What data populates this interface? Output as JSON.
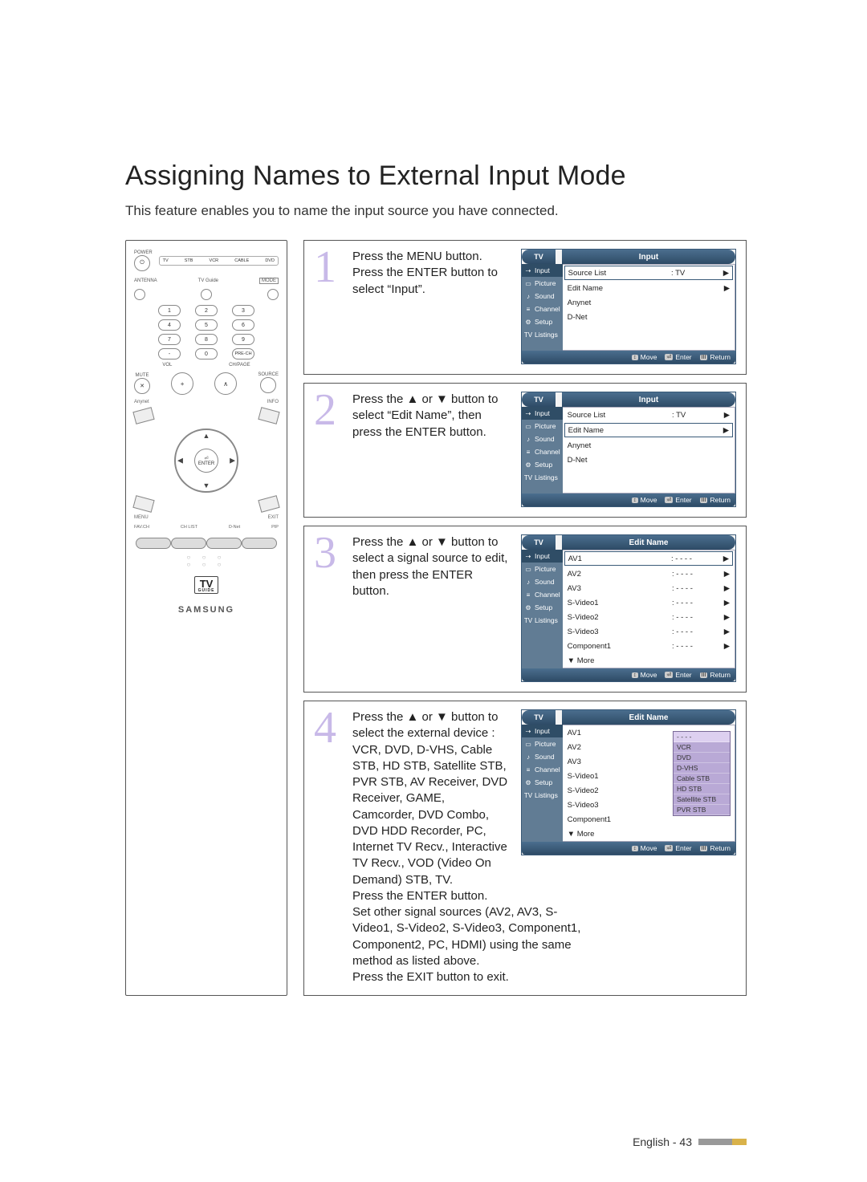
{
  "page": {
    "title": "Assigning Names to External Input Mode",
    "intro": "This feature enables you to name the input source you have connected.",
    "footer_label": "English - 43"
  },
  "remote": {
    "power": "POWER",
    "mode_strip": [
      "TV",
      "STB",
      "VCR",
      "CABLE",
      "DVD"
    ],
    "row2_labels": [
      "ANTENNA",
      "TV Guide",
      "MODE"
    ],
    "numbers": [
      "1",
      "2",
      "3",
      "4",
      "5",
      "6",
      "7",
      "8",
      "9",
      "-",
      "0",
      "PRE-CH"
    ],
    "vol_label": "VOL",
    "chpage_label": "CH/PAGE",
    "mute": "MUTE",
    "source": "SOURCE",
    "corner_tl": "Anynet",
    "corner_tr": "INFO",
    "corner_bl": "MENU",
    "corner_br": "EXIT",
    "enter": "ENTER",
    "bottom4": [
      "FAV.CH",
      "CH LIST",
      "D-Net",
      "PIP"
    ],
    "tvguide_main": "TV",
    "tvguide_sub": "GUIDE",
    "brand": "SAMSUNG"
  },
  "steps": [
    {
      "num": "1",
      "text": "Press the MENU button.\nPress the ENTER button to select “Input”.",
      "osd": {
        "title_left": "TV",
        "title_right": "Input",
        "side_items": [
          "Input",
          "Picture",
          "Sound",
          "Channel",
          "Setup",
          "Listings"
        ],
        "side_selected": 0,
        "main_rows": [
          {
            "label": "Source List",
            "value": ": TV",
            "selected": true,
            "arrow": "▶"
          },
          {
            "label": "Edit Name",
            "value": "",
            "arrow": "▶"
          },
          {
            "label": "Anynet",
            "value": "",
            "arrow": ""
          },
          {
            "label": "D-Net",
            "value": "",
            "arrow": ""
          }
        ],
        "footer": [
          "Move",
          "Enter",
          "Return"
        ]
      }
    },
    {
      "num": "2",
      "text": "Press the ▲ or ▼ button to select “Edit Name”, then press the ENTER button.",
      "osd": {
        "title_left": "TV",
        "title_right": "Input",
        "side_items": [
          "Input",
          "Picture",
          "Sound",
          "Channel",
          "Setup",
          "Listings"
        ],
        "side_selected": 0,
        "main_rows": [
          {
            "label": "Source List",
            "value": ": TV",
            "arrow": "▶"
          },
          {
            "label": "Edit Name",
            "value": "",
            "selected": true,
            "arrow": "▶"
          },
          {
            "label": "Anynet",
            "value": "",
            "arrow": ""
          },
          {
            "label": "D-Net",
            "value": "",
            "arrow": ""
          }
        ],
        "footer": [
          "Move",
          "Enter",
          "Return"
        ]
      }
    },
    {
      "num": "3",
      "text": "Press the ▲ or ▼ button to select a signal source to edit, then press the ENTER button.",
      "osd": {
        "title_left": "TV",
        "title_right": "Edit Name",
        "side_items": [
          "Input",
          "Picture",
          "Sound",
          "Channel",
          "Setup",
          "Listings"
        ],
        "side_selected": 0,
        "main_rows": [
          {
            "label": "AV1",
            "value": ": - - - -",
            "selected": true,
            "arrow": "▶"
          },
          {
            "label": "AV2",
            "value": ": - - - -",
            "arrow": "▶"
          },
          {
            "label": "AV3",
            "value": ": - - - -",
            "arrow": "▶"
          },
          {
            "label": "S-Video1",
            "value": ": - - - -",
            "arrow": "▶"
          },
          {
            "label": "S-Video2",
            "value": ": - - - -",
            "arrow": "▶"
          },
          {
            "label": "S-Video3",
            "value": ": - - - -",
            "arrow": "▶"
          },
          {
            "label": "Component1",
            "value": ": - - - -",
            "arrow": "▶"
          },
          {
            "label": "▼ More",
            "value": "",
            "arrow": ""
          }
        ],
        "footer": [
          "Move",
          "Enter",
          "Return"
        ]
      }
    },
    {
      "num": "4",
      "text": "Press the ▲ or ▼ button to select the external device : VCR, DVD, D-VHS, Cable STB, HD STB, Satellite STB, PVR STB, AV Receiver, DVD Receiver, GAME, Camcorder, DVD Combo, DVD HDD Recorder, PC, Internet TV Recv., Interactive TV Recv., VOD (Video On Demand) STB, TV.",
      "text_more": "Press the ENTER button.\nSet other signal sources (AV2, AV3, S-Video1, S-Video2, S-Video3, Component1, Component2, PC, HDMI) using the same method as listed above.",
      "text_last": "Press the EXIT button to exit.",
      "osd": {
        "title_left": "TV",
        "title_right": "Edit Name",
        "side_items": [
          "Input",
          "Picture",
          "Sound",
          "Channel",
          "Setup",
          "Listings"
        ],
        "side_selected": 0,
        "main_rows": [
          {
            "label": "AV1",
            "value": "",
            "arrow": ""
          },
          {
            "label": "AV2",
            "value": "",
            "arrow": ""
          },
          {
            "label": "AV3",
            "value": "",
            "arrow": ""
          },
          {
            "label": "S-Video1",
            "value": "",
            "arrow": ""
          },
          {
            "label": "S-Video2",
            "value": "",
            "arrow": ""
          },
          {
            "label": "S-Video3",
            "value": "",
            "arrow": ""
          },
          {
            "label": "Component1",
            "value": "",
            "arrow": ""
          },
          {
            "label": "▼ More",
            "value": "",
            "arrow": ""
          }
        ],
        "popup": [
          "- - - -",
          "VCR",
          "DVD",
          "D-VHS",
          "Cable STB",
          "HD STB",
          "Satellite STB",
          "PVR STB"
        ],
        "popup_selected": 0,
        "footer": [
          "Move",
          "Enter",
          "Return"
        ]
      }
    }
  ],
  "osd_footer_icons": {
    "move": "↕",
    "enter": "⏎",
    "return": "III"
  },
  "osd_side_labels": {
    "tv_prefix": "TV"
  }
}
